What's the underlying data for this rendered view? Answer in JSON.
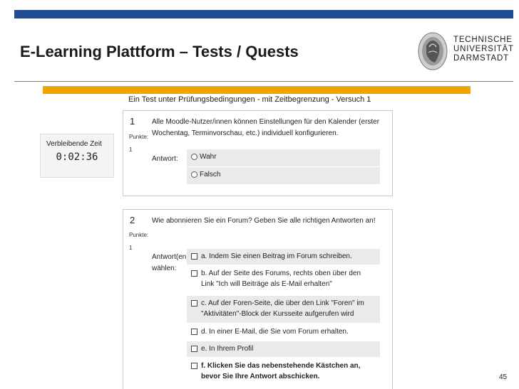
{
  "slide": {
    "title": "E-Learning Plattform – Tests / Quests",
    "page_number": "45",
    "colors": {
      "top_bar": "#1f4e92",
      "accent_bar": "#f0a400"
    }
  },
  "logo": {
    "lines": [
      "TECHNISCHE",
      "UNIVERSITÄT",
      "DARMSTADT"
    ]
  },
  "quiz": {
    "title": "Ein Test unter Prüfungsbedingungen - mit Zeitbegrenzung - Versuch 1",
    "timer": {
      "label": "Verbleibende Zeit",
      "value": "0:02:36"
    },
    "questions": [
      {
        "number": "1",
        "points_label": "Punkte:",
        "points_value": "1",
        "text": "Alle Moodle-Nutzer/innen können Einstellungen für den Kalender (erster Wochentag, Terminvorschau, etc.) individuell konfigurieren.",
        "answer_label": "Antwort:",
        "options": [
          "Wahr",
          "Falsch"
        ]
      },
      {
        "number": "2",
        "points_label": "Punkte:",
        "points_value": "1",
        "text": "Wie abonnieren Sie ein Forum? Geben Sie alle richtigen Antworten an!",
        "answer_label": "Antwort(en) wählen:",
        "options": [
          "a. Indem Sie einen Beitrag im Forum schreiben.",
          "b. Auf der Seite des Forums, rechts oben über den Link \"Ich will Beiträge als E-Mail erhalten\"",
          "c. Auf der Foren-Seite, die über den Link \"Foren\" im \"Aktivitäten\"-Block der Kursseite aufgerufen wird",
          "d. In einer E-Mail, die Sie vom Forum erhalten.",
          "e. In Ihrem Profil",
          "f. Klicken Sie das nebenstehende Kästchen an, bevor Sie Ihre Antwort abschicken."
        ]
      }
    ]
  }
}
